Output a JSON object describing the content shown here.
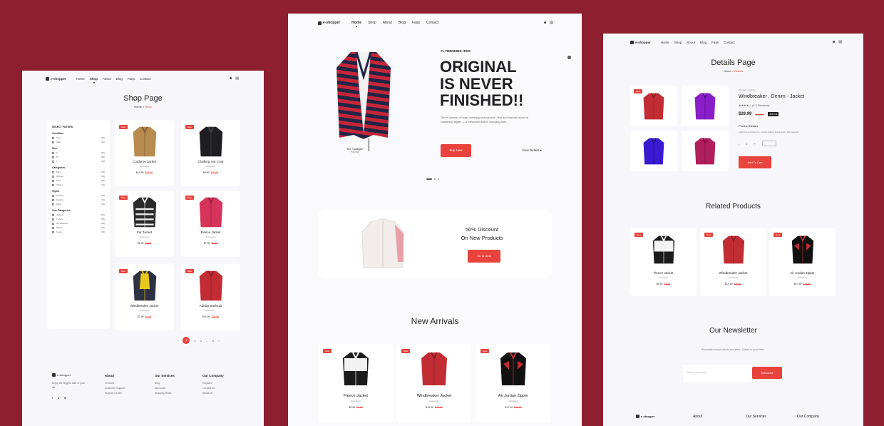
{
  "nav": {
    "logo": "e-shopper",
    "links": [
      "Home",
      "Shop",
      "About",
      "Blog",
      "Faqs",
      "Contact"
    ]
  },
  "shop": {
    "title": "Shop Page",
    "crumb_home": "Home",
    "crumb_sep": " > ",
    "crumb_current": "Shop",
    "filters_title": "SELECT FILTERS",
    "filter_groups": [
      {
        "title": "Condition",
        "items": [
          [
            "New",
            "(20)"
          ],
          [
            "Sale",
            "(10)"
          ]
        ]
      },
      {
        "title": "Size",
        "items": [
          [
            "S",
            "(20)"
          ],
          [
            "M",
            "(30)"
          ],
          [
            "L",
            "(20)"
          ]
        ]
      },
      {
        "title": "Categories",
        "items": [
          [
            "Men",
            "(20)"
          ],
          [
            "Women",
            "(30)"
          ],
          [
            "Kids",
            "(20)"
          ],
          [
            "Others",
            "(10)"
          ]
        ]
      },
      {
        "title": "Styles",
        "items": [
          [
            "Casual",
            "(20)"
          ],
          [
            "Formal",
            "(30)"
          ],
          [
            "Party",
            "(20)"
          ]
        ]
      },
      {
        "title": "Sub Categories",
        "items": [
          [
            "Jackets",
            "(20)"
          ],
          [
            "T-shirts",
            "(30)"
          ],
          [
            "Accessories",
            "(20)"
          ],
          [
            "Shoes",
            "(10)"
          ],
          [
            "Coats",
            "(10)"
          ]
        ]
      }
    ],
    "products": [
      {
        "name": "Corduroy Jacket",
        "cat": "Accessory",
        "price": "$14.99",
        "old": "$25.99",
        "badge": "Sale"
      },
      {
        "name": "Clothing Hot Coat",
        "cat": "Accessory",
        "price": "$9.99",
        "old": "$20.99",
        "badge": "Sale"
      },
      {
        "name": "Fur Jacket",
        "cat": "Accessory",
        "price": "$4.99",
        "old": "$9.99",
        "badge": "Sale"
      },
      {
        "name": "Fleece Jacket",
        "cat": "Accessory",
        "price": "$7.99",
        "old": "$9.99",
        "badge": "Sale"
      },
      {
        "name": "Windbreaker Jacket",
        "cat": "Accessory",
        "price": "$7.99",
        "old": "$9.99",
        "badge": "Sale"
      },
      {
        "name": "Adidas tracksuit",
        "cat": "Accessory",
        "price": "$14.99",
        "old": "$25.99",
        "badge": "Sale"
      }
    ],
    "pagination": [
      "‹",
      "1",
      "2",
      "3",
      "...",
      "6",
      "›"
    ],
    "footer": {
      "tagline": "Enjoy the biggest sale of your life",
      "cols": [
        {
          "title": "About",
          "items": [
            "Vendors",
            "Customer Support",
            "Support Center"
          ]
        },
        {
          "title": "Our Services",
          "items": [
            "Blog",
            "Discounts",
            "Shipping Rules"
          ]
        },
        {
          "title": "Our Company",
          "items": [
            "Register",
            "Contact us",
            "About Us"
          ]
        }
      ]
    }
  },
  "home": {
    "hero_kicker": "#1 TRENDING ITEM",
    "hero_line1": "ORIGINAL",
    "hero_line2": "IS NEVER",
    "hero_line3": "FINISHED!!",
    "hero_desc": "This is a piece of hope, meaning and purpose. Visit and become a part of something bigger — a movement that is changing lives.",
    "buy_label": "Buy Now",
    "view_label": "View Details",
    "hero_tag": "The \"Cardigan\"",
    "hero_tag_sub": "Popular",
    "discount_line1": "50% Discount",
    "discount_line2": "On New Products",
    "discount_btn": "Go to Deal",
    "arrivals_title": "New Arrivals",
    "arrivals": [
      {
        "name": "Fleece Jacket",
        "cat": "Accessory",
        "price": "$5.99",
        "old": "$9.99",
        "badge": "New"
      },
      {
        "name": "Windbreaker Jacket",
        "cat": "Accessory",
        "price": "$14.90",
        "old": "$25.99",
        "badge": "New"
      },
      {
        "name": "Air Jordan Zipper",
        "cat": "Accessory",
        "price": "$17.49",
        "old": "$25.99",
        "badge": "New"
      }
    ]
  },
  "details": {
    "title": "Details Page",
    "crumb_home": "Home",
    "crumb_sep": " > ",
    "crumb_current": "Details",
    "product_cat": "Women > Jackets",
    "product_name": "Windbreaker , Denim - Jacket",
    "reviews": "(4.1 Reviews)",
    "price": "$29.99",
    "old": "$49.99",
    "badge": "-40% Off",
    "details_label": "Product Details",
    "details_text": "Light Kid and Kids Tee, Cotton Fabric, Hand wash, 90s Sweater",
    "qty": "1",
    "qty_minus": "-",
    "qty_plus": "+",
    "cart_btn": "Add To Cart",
    "related_title": "Related Products",
    "related": [
      {
        "name": "Fleece Jacket",
        "cat": "Accessory",
        "price": "$5.99",
        "old": "$9.99",
        "badge": "New"
      },
      {
        "name": "Windbreaker Jacket",
        "cat": "Accessory",
        "price": "$14.90",
        "old": "$25.99",
        "badge": "New"
      },
      {
        "name": "Air Jordan Zipper",
        "cat": "Accessory",
        "price": "$17.49",
        "old": "$25.99",
        "badge": "New"
      }
    ],
    "newsletter_title": "Our Newsletter",
    "newsletter_text": "Remember new products and sales. Create to your inbox",
    "email_placeholder": "Enter your e-mail",
    "subscribe": "Subscribe",
    "footer_cols": [
      "About",
      "Our Services",
      "Our Company"
    ]
  },
  "colors": {
    "accent": "#e8433d",
    "background": "#8e1f2e"
  }
}
